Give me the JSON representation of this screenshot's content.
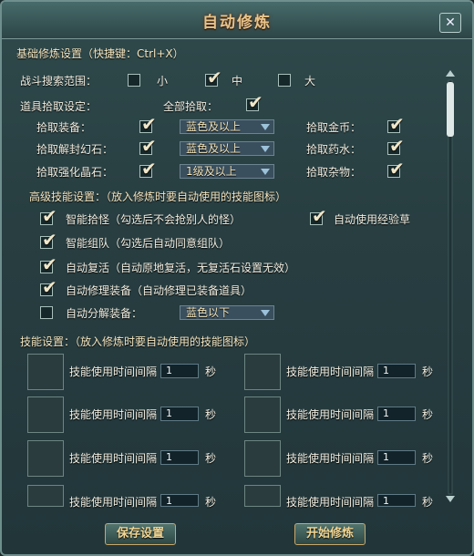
{
  "window": {
    "title": "自动修炼",
    "close_icon": "close-icon"
  },
  "basic": {
    "header": "基础修炼设置（快捷键：Ctrl+X）"
  },
  "search": {
    "label": "战斗搜索范围：",
    "options": [
      {
        "label": "小",
        "checked": false
      },
      {
        "label": "中",
        "checked": true
      },
      {
        "label": "大",
        "checked": false
      }
    ]
  },
  "pickup": {
    "label": "道具拾取设定：",
    "all_label": "全部拾取：",
    "all_checked": true,
    "rows": [
      {
        "left_label": "拾取装备：",
        "left_checked": true,
        "select": "蓝色及以上",
        "right_label": "拾取金币：",
        "right_checked": true
      },
      {
        "left_label": "拾取解封幻石：",
        "left_checked": true,
        "select": "蓝色及以上",
        "right_label": "拾取药水：",
        "right_checked": true
      },
      {
        "left_label": "拾取强化晶石：",
        "left_checked": true,
        "select": "1级及以上",
        "right_label": "拾取杂物：",
        "right_checked": true
      }
    ]
  },
  "advanced": {
    "header": "高级技能设置：（放入修炼时要自动使用的技能图标）",
    "items": [
      {
        "label": "智能拾怪（勾选后不会抢别人的怪）",
        "checked": true
      },
      {
        "label": "智能组队（勾选后自动同意组队）",
        "checked": true
      },
      {
        "label": "自动复活（自动原地复活，无复活石设置无效）",
        "checked": true
      },
      {
        "label": "自动修理装备（自动修理已装备道具）",
        "checked": true
      }
    ],
    "exp_label": "自动使用经验草",
    "exp_checked": true,
    "decompose": {
      "label": "自动分解装备：",
      "checked": false,
      "select": "蓝色以下"
    }
  },
  "skills": {
    "header": "技能设置：（放入修炼时要自动使用的技能图标）",
    "interval_label": "技能使用时间间隔",
    "unit": "秒",
    "left": [
      "1",
      "1",
      "1",
      "1"
    ],
    "right": [
      "1",
      "1",
      "1",
      "1"
    ]
  },
  "buttons": {
    "save": "保存设置",
    "start": "开始修炼"
  },
  "colors": {
    "accent_title": "#e8c48a",
    "button_text": "#f1d592",
    "panel": "#2c4446"
  }
}
